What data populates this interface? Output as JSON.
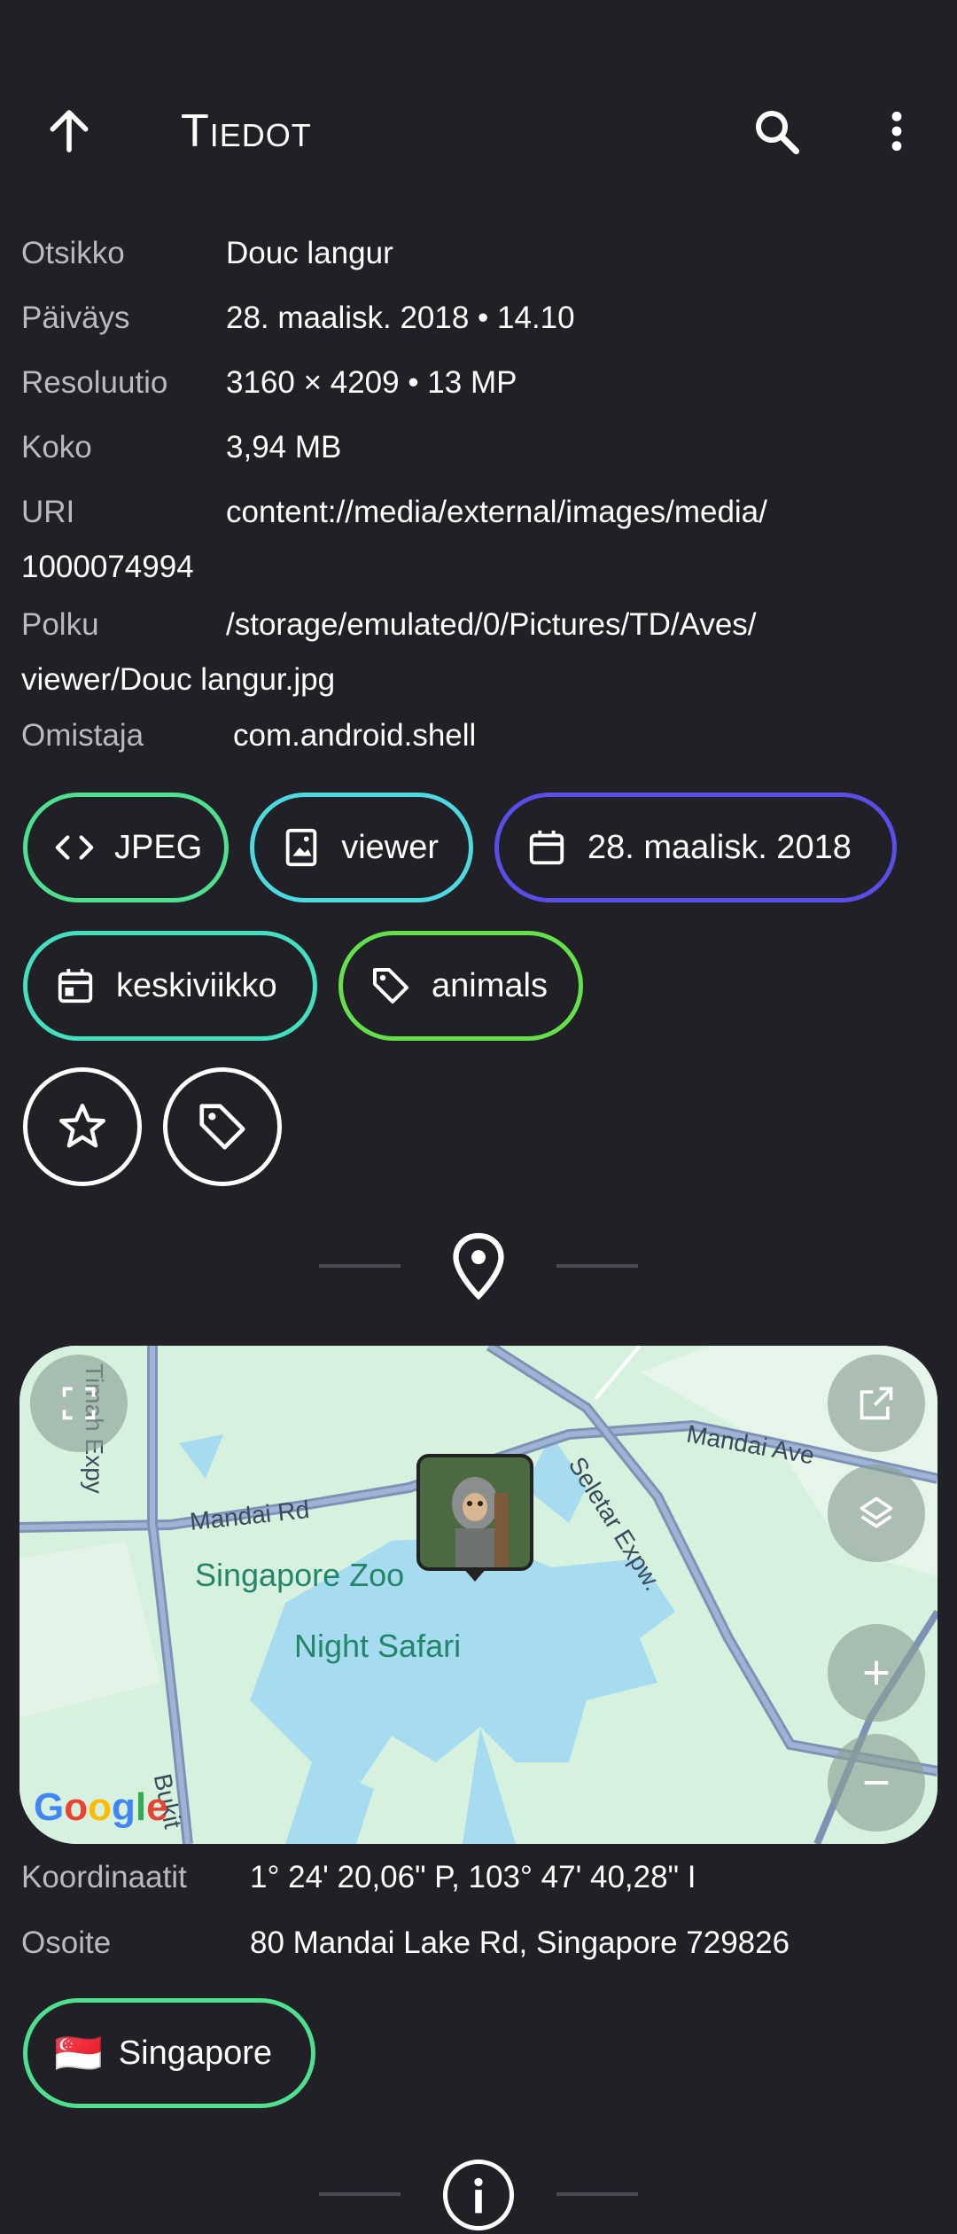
{
  "appbar": {
    "title": "Tiedot",
    "back_icon": "arrow-up-icon",
    "search_icon": "search-icon",
    "menu_icon": "more-vert-icon"
  },
  "info": {
    "title_label": "Otsikko",
    "title_value": "Douc langur",
    "date_label": "Päiväys",
    "date_value": "28. maalisk. 2018 • 14.10",
    "resolution_label": "Resoluutio",
    "resolution_value": "3160 × 4209 • 13 MP",
    "size_label": "Koko",
    "size_value": "3,94 MB",
    "uri_label": "URI",
    "uri_value_1": "content://media/external/images/media/",
    "uri_value_2": "1000074994",
    "path_label": "Polku",
    "path_value_1": "/storage/emulated/0/Pictures/TD/Aves/",
    "path_value_2": "viewer/Douc langur.jpg",
    "owner_label": "Omistaja",
    "owner_value": "com.android.shell"
  },
  "chips": {
    "format": "JPEG",
    "album": "viewer",
    "date": "28. maalisk. 2018",
    "weekday": "keskiviikko",
    "tag": "animals"
  },
  "colors": {
    "background": "#202026",
    "chip_green": "#4ee08e",
    "chip_cyan": "#4dd9e0",
    "chip_purple": "#5b4ee8",
    "chip_teal": "#43e0c0",
    "chip_lime": "#63e04a",
    "label_gray": "#b9b9bf"
  },
  "map": {
    "labels": {
      "zoo": "Singapore Zoo",
      "safari": "Night Safari",
      "mandai_rd": "Mandai Rd",
      "mandai_ave": "Mandai Ave",
      "seletar": "Seletar Expw.",
      "timah": "Timah Expy",
      "bukit": "Bukit",
      "google": "Google"
    }
  },
  "location": {
    "coords_label": "Koordinaatit",
    "coords_value": "1° 24' 20,06\" P, 103° 47' 40,28\" I",
    "address_label": "Osoite",
    "address_value": "80 Mandai Lake Rd, Singapore 729826",
    "country_flag": "🇸🇬",
    "country": "Singapore"
  }
}
